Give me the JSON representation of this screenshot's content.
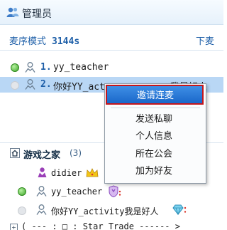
{
  "header": {
    "title": "管理员",
    "icon": "user-group-icon"
  },
  "mic_mode": {
    "label": "麦序模式",
    "time": "3144s",
    "down_label": "下麦"
  },
  "queue": [
    {
      "index": "1.",
      "name": "yy_teacher",
      "status": "green"
    },
    {
      "index": "2.",
      "name": "你好YY_act",
      "name_tail": "我是好人",
      "status": "gray",
      "selected": true
    }
  ],
  "context_menu": {
    "items": [
      "邀请连麦",
      "发送私聊",
      "个人信息",
      "所在公会",
      "加为好友"
    ],
    "highlight_color": "#c4161c"
  },
  "group": {
    "title": "游戏之家",
    "count": "(3)"
  },
  "members": [
    {
      "name": "didier",
      "status": "none",
      "badge": "crown-icon"
    },
    {
      "name": "yy_teacher",
      "status": "green",
      "badge": "shield-icon"
    },
    {
      "name": "你好YY_activity我是好人",
      "status": "gray",
      "badge": "diamond-icon"
    }
  ],
  "footer": {
    "text": "( --- : □ : Star Trade ------ >"
  }
}
